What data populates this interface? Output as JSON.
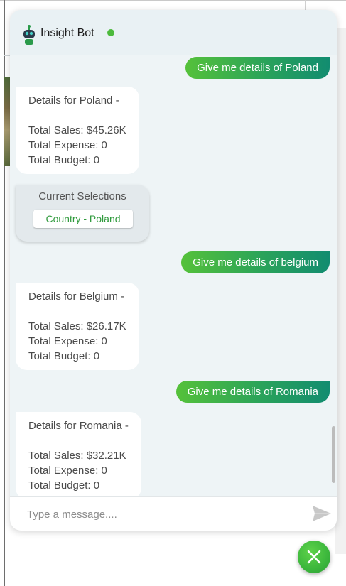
{
  "header": {
    "bot_name": "Insight Bot",
    "online_color": "#4cba3c",
    "avatar_icon": "robot-icon"
  },
  "messages": [
    {
      "role": "user",
      "text": "Give me details of Poland"
    },
    {
      "role": "bot",
      "lines": [
        "Details for Poland -",
        "",
        "Total Sales: $45.26K",
        "Total Expense: 0",
        "Total Budget: 0"
      ]
    },
    {
      "role": "selections",
      "title": "Current Selections",
      "chip": "Country - Poland"
    },
    {
      "role": "user",
      "text": "Give me details of belgium"
    },
    {
      "role": "bot",
      "lines": [
        "Details for Belgium -",
        "",
        "Total Sales: $26.17K",
        "Total Expense: 0",
        "Total Budget: 0"
      ]
    },
    {
      "role": "user",
      "text": "Give me details of Romania"
    },
    {
      "role": "bot",
      "lines": [
        "Details for Romania -",
        "",
        "Total Sales: $32.21K",
        "Total Expense: 0",
        "Total Budget: 0"
      ]
    }
  ],
  "input": {
    "placeholder": "Type a message....",
    "value": "",
    "send_icon": "send-icon"
  },
  "close_button": {
    "icon": "close-icon"
  },
  "colors": {
    "accent_start": "#55c13a",
    "accent_end": "#128c70",
    "chip_text": "#2f9a3c"
  }
}
